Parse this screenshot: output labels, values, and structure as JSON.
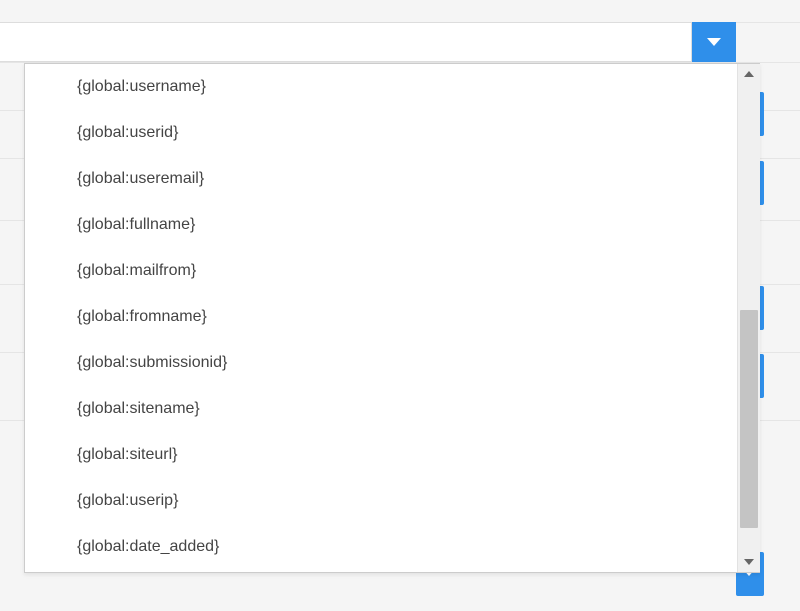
{
  "accent_color": "#2f8fea",
  "input": {
    "value": "",
    "placeholder": ""
  },
  "options": [
    "{global:username}",
    "{global:userid}",
    "{global:useremail}",
    "{global:fullname}",
    "{global:mailfrom}",
    "{global:fromname}",
    "{global:submissionid}",
    "{global:sitename}",
    "{global:siteurl}",
    "{global:userip}",
    "{global:date_added}"
  ]
}
